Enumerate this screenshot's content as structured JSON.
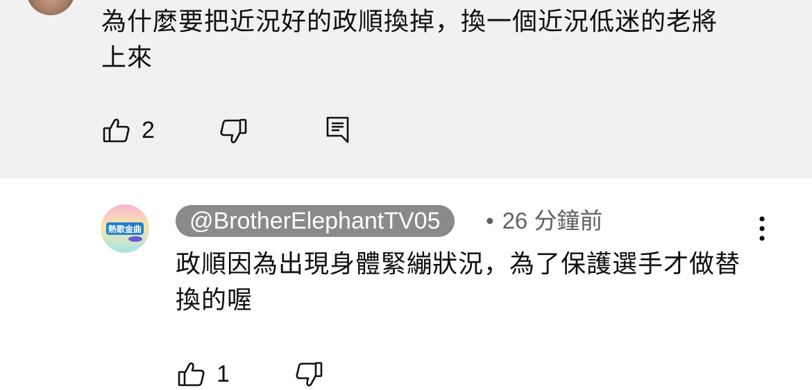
{
  "previous_comment": {
    "text": "為什麼要把近況好的政順換掉，換一個近況低迷的老將上來",
    "like_count": "2",
    "icons": {
      "avatar": "user-avatar-photo",
      "more": "more-vert-icon",
      "like": "thumb-up-icon",
      "dislike": "thumb-down-icon",
      "reply": "reply-comment-icon"
    }
  },
  "reply": {
    "handle": "@BrotherElephantTV05",
    "separator": "•",
    "time": "26 分鐘前",
    "text": "政順因為出現身體緊繃狀況，為了保護選手才做替換的喔",
    "like_count": "1",
    "avatar_logo_text": "熱歌金曲",
    "icons": {
      "avatar": "channel-logo-avatar",
      "more": "more-vert-icon",
      "like": "thumb-up-icon",
      "dislike": "thumb-down-icon"
    }
  },
  "colors": {
    "highlight_background": "#f1f1f1",
    "handle_pill": "#8a8a8a",
    "meta_text": "#606060",
    "primary_text": "#0f0f0f"
  }
}
